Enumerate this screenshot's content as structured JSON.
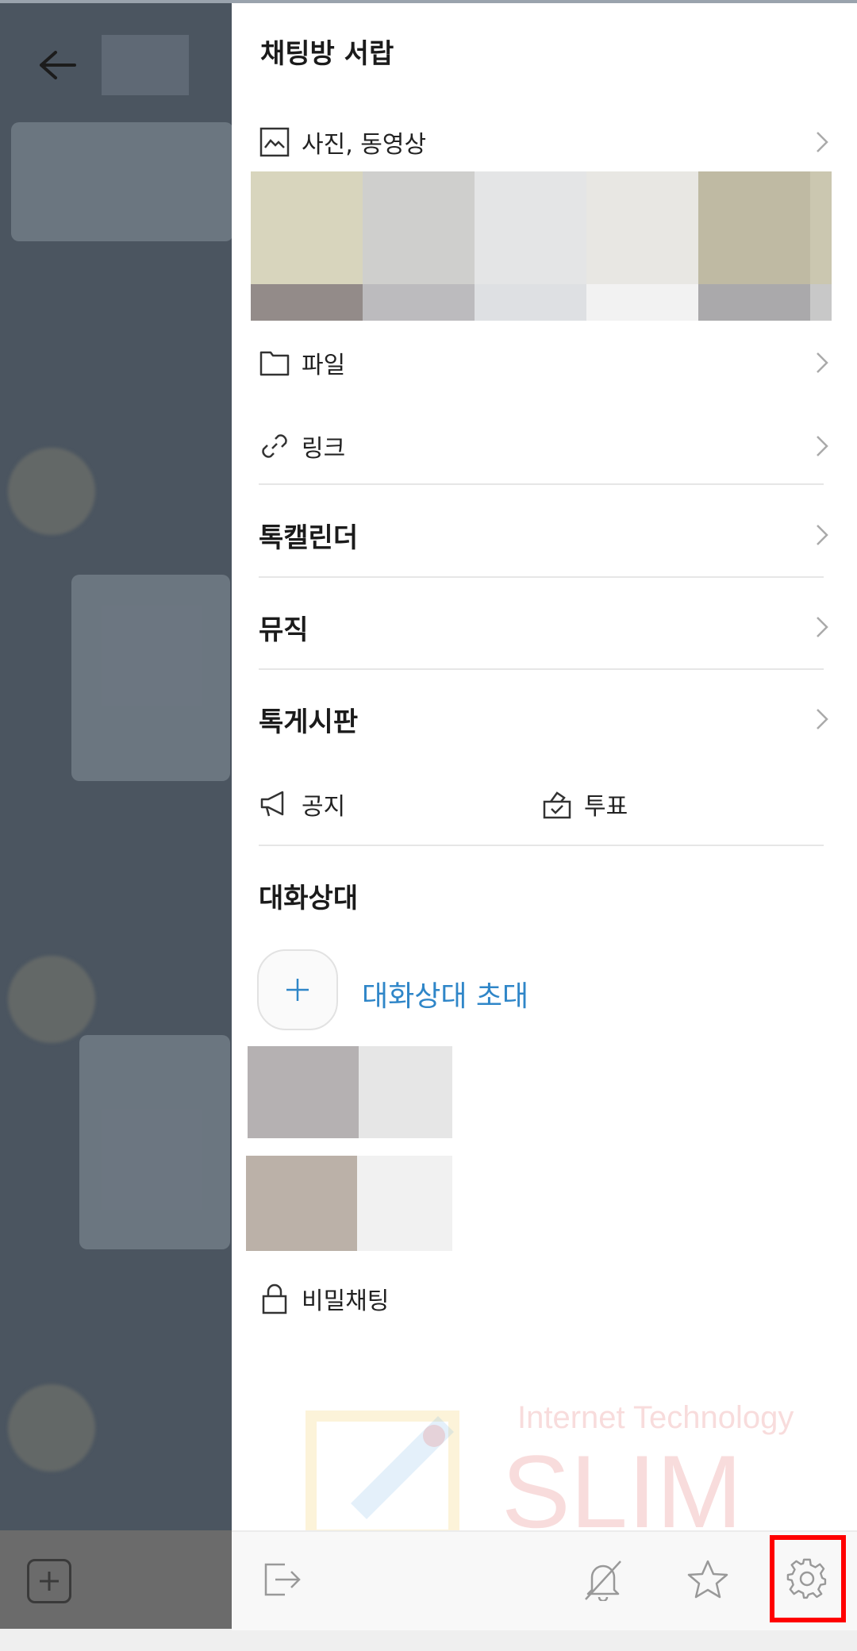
{
  "drawer": {
    "title": "채팅방 서랍",
    "photos_label": "사진, 동영상",
    "files_label": "파일",
    "links_label": "링크",
    "calendar_label": "톡캘린더",
    "music_label": "뮤직",
    "board_label": "톡게시판",
    "notice_label": "공지",
    "vote_label": "투표",
    "members_title": "대화상대",
    "invite_label": "대화상대 초대",
    "secret_chat_label": "비밀채팅"
  },
  "media_thumbs": [
    {
      "top": "#d8d5bd",
      "bottom": "#938b89"
    },
    {
      "top": "#cfcfcd",
      "bottom": "#bcbbbe"
    },
    {
      "top": "#e4e5e6",
      "bottom": "#dee0e3"
    },
    {
      "top": "#e8e7e3",
      "bottom": "#f2f2f2"
    },
    {
      "top": "#bfbaa3",
      "bottom": "#aaa9ab"
    },
    {
      "top": "#cbc7b0",
      "bottom": "#c8c8c8"
    }
  ],
  "watermark": {
    "line1": "Internet Technology",
    "line2": "SLIM"
  },
  "colors": {
    "accent": "#2f86c8",
    "highlight": "#ff0000",
    "overlay": "#4b5560"
  },
  "toolbar_icons": [
    "exit-icon",
    "bell-off-icon",
    "star-icon",
    "gear-icon"
  ]
}
